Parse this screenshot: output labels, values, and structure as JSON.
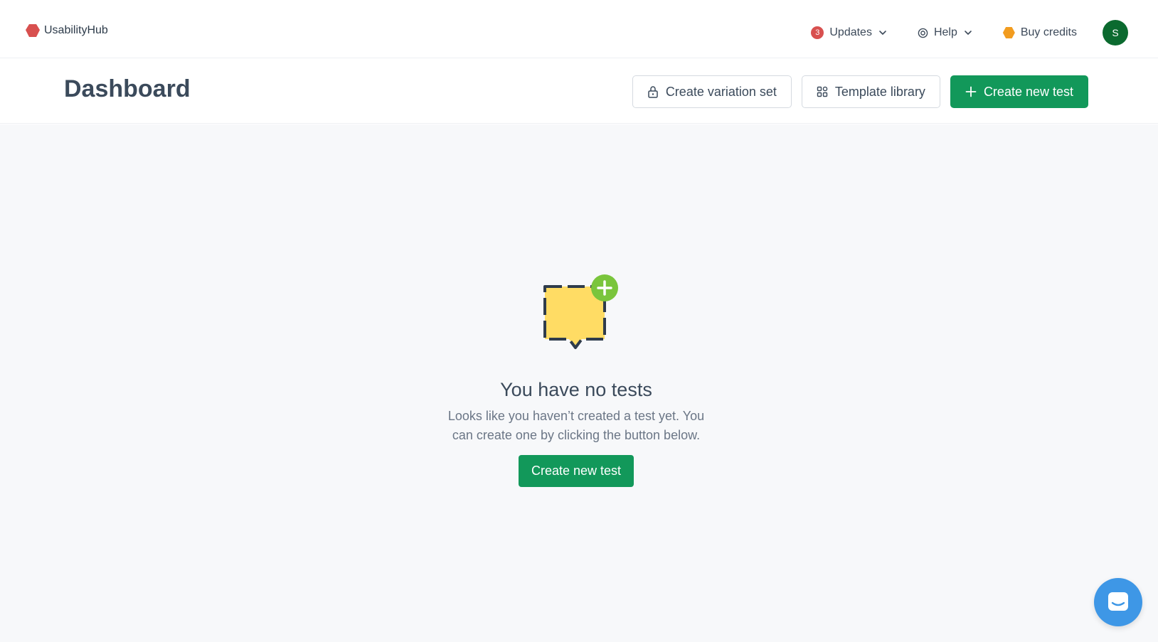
{
  "nav": {
    "brand": "UsabilityHub",
    "updates_badge": "3",
    "updates_label": "Updates",
    "help_label": "Help",
    "buy_credits_label": "Buy credits",
    "avatar_initial": "S"
  },
  "header": {
    "title": "Dashboard",
    "create_variation_set": "Create variation set",
    "template_library": "Template library",
    "create_new_test": "Create new test"
  },
  "empty_state": {
    "title": "You have no tests",
    "description": "Looks like you haven’t created a test yet. You can create one by clicking the button below.",
    "button": "Create new test"
  },
  "colors": {
    "primary_green": "#12985a",
    "brand_red": "#d8504f",
    "credits_orange": "#f29c1f",
    "avatar_green": "#0b6a2f",
    "chat_blue": "#3e97e6"
  },
  "icons": {
    "logo": "usabilityhub-logo-icon",
    "updates": "updates-badge",
    "help": "help-lifebuoy-icon",
    "credits": "credits-coin-icon",
    "lock": "lock-icon",
    "template": "grid-icon",
    "plus": "plus-icon",
    "chat": "chat-icon"
  }
}
